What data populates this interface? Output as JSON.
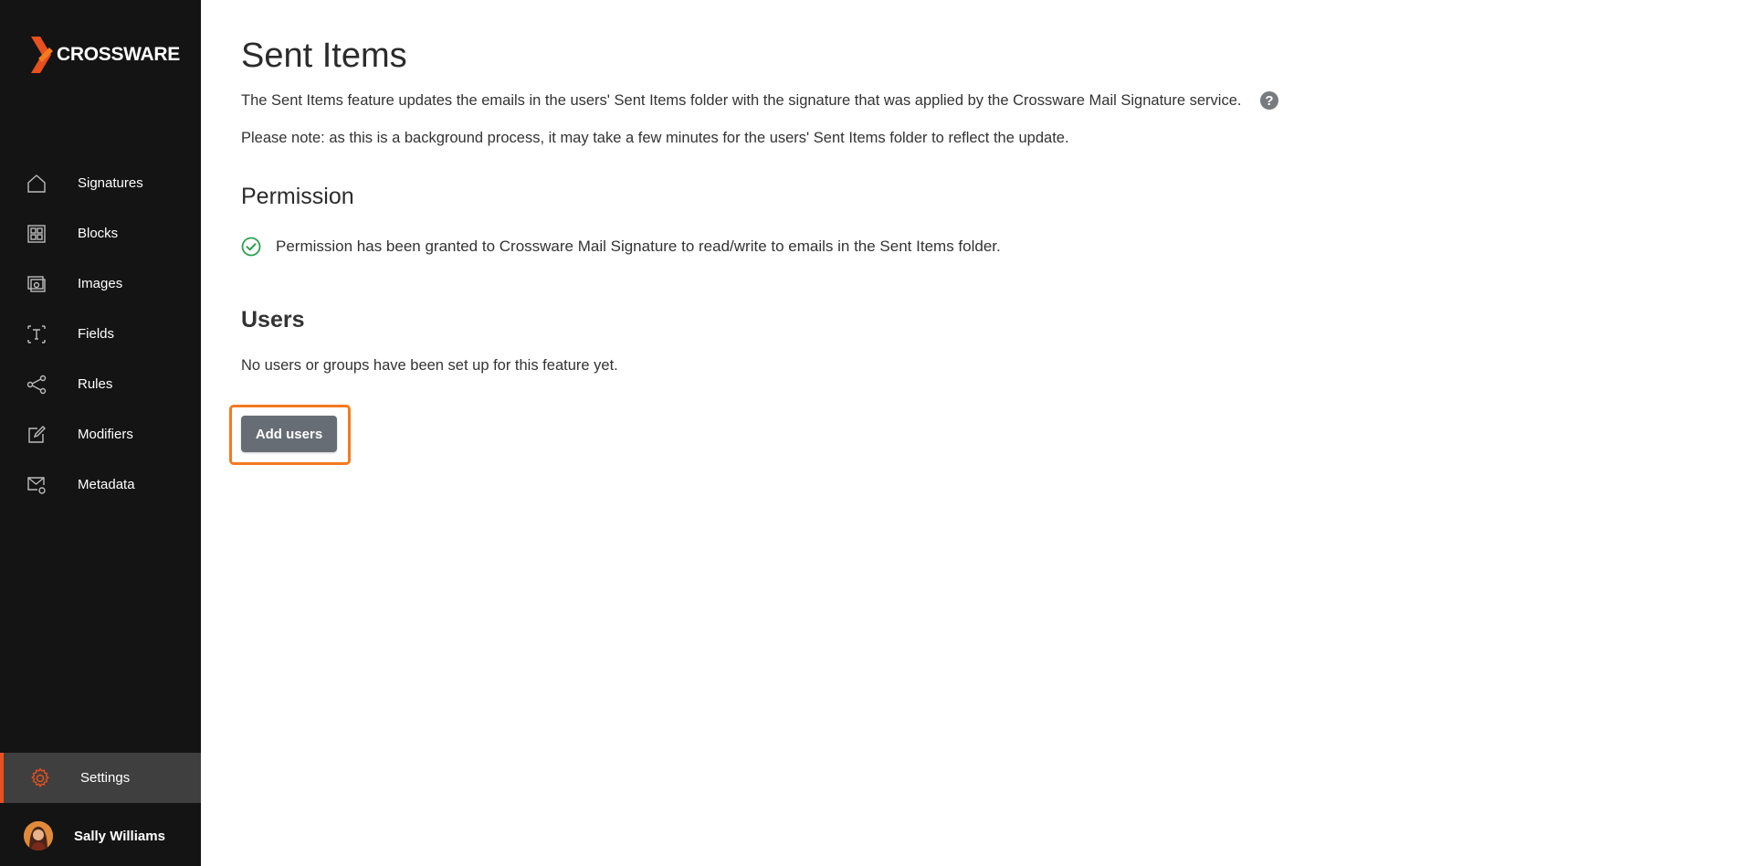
{
  "brand": {
    "name": "CROSSWARE",
    "accent": "#e8501e"
  },
  "sidebar": {
    "items": [
      {
        "label": "Signatures",
        "icon": "home-icon"
      },
      {
        "label": "Blocks",
        "icon": "blocks-icon"
      },
      {
        "label": "Images",
        "icon": "images-icon"
      },
      {
        "label": "Fields",
        "icon": "fields-icon"
      },
      {
        "label": "Rules",
        "icon": "share-icon"
      },
      {
        "label": "Modifiers",
        "icon": "edit-icon"
      },
      {
        "label": "Metadata",
        "icon": "mail-settings-icon"
      }
    ],
    "settings": {
      "label": "Settings",
      "icon": "gear-icon",
      "active": true
    },
    "user": {
      "name": "Sally Williams"
    }
  },
  "main": {
    "title": "Sent Items",
    "description": "The Sent Items feature updates the emails in the users' Sent Items folder with the signature that was applied by the Crossware Mail Signature service.",
    "note": "Please note: as this is a background process, it may take a few minutes for the users' Sent Items folder to reflect the update.",
    "permission": {
      "title": "Permission",
      "status_text": "Permission has been granted to Crossware Mail Signature to read/write to emails in the Sent Items folder.",
      "status_color": "#2e9e4f"
    },
    "users": {
      "title": "Users",
      "empty_text": "No users or groups have been set up for this feature yet.",
      "add_button_label": "Add users"
    }
  }
}
